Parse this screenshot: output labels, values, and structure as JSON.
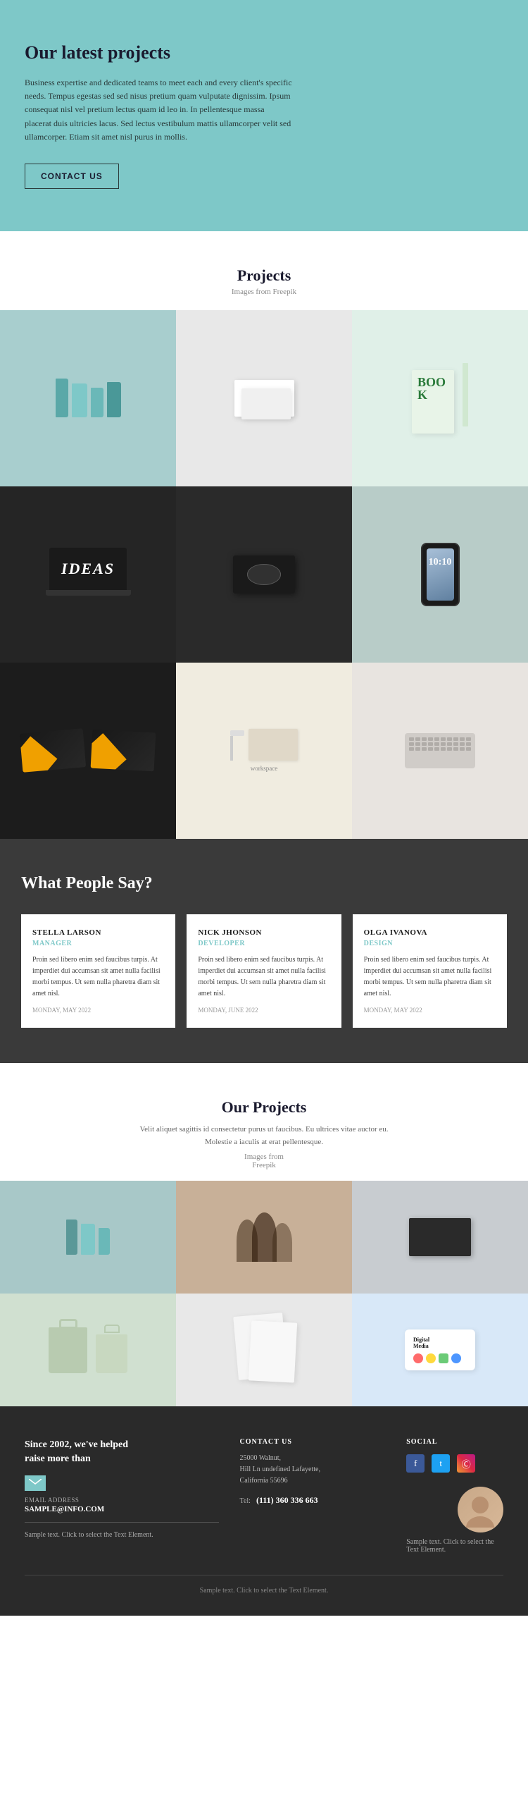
{
  "hero": {
    "title": "Our latest projects",
    "description": "Business expertise and dedicated teams to meet each and every client's specific needs. Tempus egestas sed sed nisus pretium quam vulputate dignissim. Ipsum consequat nisl vel pretium lectus quam id leo in. In pellentesque massa placerat duis ultricies lacus. Sed lectus vestibulum mattis ullamcorper velit sed ullamcorper. Etiam sit amet nisl purus in mollis.",
    "cta_label": "CONTACT US",
    "bg_color": "#7ec8c8"
  },
  "projects_section": {
    "title": "Projects",
    "subtitle": "Images from Freepik",
    "grid": [
      {
        "id": 1,
        "alt": "Books stack teal",
        "type": "books"
      },
      {
        "id": 2,
        "alt": "Business card white",
        "type": "bizcard_white"
      },
      {
        "id": 3,
        "alt": "Book cover colorful",
        "type": "bookcover"
      },
      {
        "id": 4,
        "alt": "Ideas laptop dark",
        "type": "ideas_laptop"
      },
      {
        "id": 5,
        "alt": "Business card dark",
        "type": "bizcard_dark"
      },
      {
        "id": 6,
        "alt": "Smartphone 10:10",
        "type": "phone"
      },
      {
        "id": 7,
        "alt": "Design business card orange",
        "type": "design_card"
      },
      {
        "id": 8,
        "alt": "Desk lamp setup",
        "type": "desk"
      },
      {
        "id": 9,
        "alt": "Keyboard top view",
        "type": "keyboard"
      }
    ]
  },
  "testimonials": {
    "title": "What People Say?",
    "bg_color": "#3a3a3a",
    "items": [
      {
        "name": "STELLA LARSON",
        "role": "MANAGER",
        "text": "Proin sed libero enim sed faucibus turpis. At imperdiet dui accumsan sit amet nulla facilisi morbi tempus. Ut sem nulla pharetra diam sit amet nisl.",
        "date": "MONDAY, MAY 2022"
      },
      {
        "name": "NICK JHONSON",
        "role": "DEVELOPER",
        "text": "Proin sed libero enim sed faucibus turpis. At imperdiet dui accumsan sit amet nulla facilisi morbi tempus. Ut sem nulla pharetra diam sit amet nisl.",
        "date": "MONDAY, JUNE 2022"
      },
      {
        "name": "OLGA IVANOVA",
        "role": "DESIGN",
        "text": "Proin sed libero enim sed faucibus turpis. At imperdiet dui accumsan sit amet nulla facilisi morbi tempus. Ut sem nulla pharetra diam sit amet nisl.",
        "date": "MONDAY, MAY 2022"
      }
    ]
  },
  "our_projects": {
    "title": "Our Projects",
    "description": "Velit aliquet sagittis id consectetur purus ut faucibus. Eu ultrices vitae auctor eu. Molestie a iaculis at erat pellentesque.",
    "images_from": "Images from\nFreepik",
    "grid": [
      {
        "id": 1,
        "alt": "Books teal",
        "type": "books2"
      },
      {
        "id": 2,
        "alt": "Team working",
        "type": "team"
      },
      {
        "id": 3,
        "alt": "Business card dark",
        "type": "bizcard3"
      },
      {
        "id": 4,
        "alt": "Shopping bags green",
        "type": "bags"
      },
      {
        "id": 5,
        "alt": "White paper folded",
        "type": "whitepaper"
      },
      {
        "id": 6,
        "alt": "Digital Media",
        "type": "digital"
      }
    ]
  },
  "footer": {
    "tagline": "Since 2002, we've helped\nraise more than",
    "email_label": "EMAIL ADDRESS",
    "email_value": "SAMPLE@INFO.COM",
    "sample_text": "Sample text. Click to select the Text Element.",
    "contact": {
      "title": "CONTACT US",
      "address": "25000 Walnut,\nHill Ln undefined Lafayette,\nCalifornia 55696",
      "tel_label": "Tel:",
      "tel_value": "(111) 360 336 663"
    },
    "social": {
      "title": "SOCIAL",
      "icons": [
        "f",
        "t",
        "i"
      ],
      "icon_labels": [
        "facebook-icon",
        "twitter-icon",
        "instagram-icon"
      ]
    },
    "sample_text2": "Sample text. Click to select\nthe Text Element.",
    "bottom_text": "Sample text. Click to select the Text Element."
  }
}
